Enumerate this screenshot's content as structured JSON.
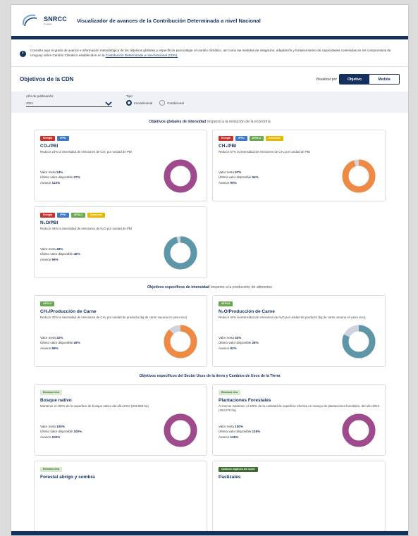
{
  "header": {
    "logo_text": "SNRCC",
    "logo_sub": "Uruguay",
    "title": "Visualizador de avances de la Contribución Determinada a nivel Nacional"
  },
  "intro": {
    "text": "Consulte aquí el grado de avance e información metodológica de los objetivos globales y específicos para mitigar el cambio climático, así como las medidas de mitigación, adaptación y fortalecimiento de capacidades contenidas en los compromisos de Uruguay sobre Cambio Climático establecidos en la ",
    "link": "Contribución Determinada a nivel Nacional (CDN)."
  },
  "section": {
    "title": "Objetivos de la CDN",
    "view_label": "Visualizar por",
    "view_options": [
      "Objetivo",
      "Medida"
    ]
  },
  "filters": {
    "year_label": "Año de publicación:",
    "year_value": "2021",
    "type_label": "Tipo:",
    "type_options": [
      "Incondicional",
      "Condicional"
    ]
  },
  "groups": [
    {
      "title": "Objetivos globales de intensidad",
      "subtitle": "respecto a la evolución de la economía"
    },
    {
      "title": "Objetivos específicos de intensidad",
      "subtitle": "respecto a la producción de alimentos"
    },
    {
      "title": "Objetivos específicos del Sector Usos de la tierra y Cambios de Usos de la Tierra",
      "subtitle": ""
    }
  ],
  "metric_labels": {
    "goal": "Valor meta",
    "last": "Último valor disponible",
    "progress": "Avance"
  },
  "colors": {
    "navy": "#14305f",
    "purple": "#9e4a8c",
    "orange": "#ef8a45",
    "teal": "#5d97a7",
    "track": "#cfd3dd"
  },
  "cards": [
    {
      "tags": [
        [
          "Energía",
          "#c9302c"
        ],
        [
          "IPPU",
          "#3e79c7"
        ]
      ],
      "title": "CO₂/PBI",
      "desc": "Reducir 24% la intensidad de emisiones de CO₂ por unidad de PBI",
      "goal": "24%",
      "last": "27%",
      "progress": "113%",
      "fill": 1.0,
      "color": "#9e4a8c"
    },
    {
      "tags": [
        [
          "Energía",
          "#c9302c"
        ],
        [
          "IPPU",
          "#3e79c7"
        ],
        [
          "AFOLU",
          "#6aa84f"
        ],
        [
          "Desechos",
          "#e6b800"
        ]
      ],
      "title": "CH₄/PBI",
      "desc": "Reducir 57% la intensidad de emisiones de CH₄ por unidad de PBI",
      "goal": "57%",
      "last": "54%",
      "progress": "95%",
      "fill": 0.95,
      "color": "#ef8a45"
    },
    {
      "tags": [
        [
          "Energía",
          "#c9302c"
        ],
        [
          "IPPU",
          "#3e79c7"
        ],
        [
          "AFOLU",
          "#6aa84f"
        ],
        [
          "Desechos",
          "#e6b800"
        ]
      ],
      "title": "N₂O/PBI",
      "desc": "Reducir 48% la intensidad de emisiones de N₂O por unidad de PBI",
      "goal": "48%",
      "last": "46%",
      "progress": "96%",
      "fill": 0.96,
      "color": "#5d97a7"
    },
    {
      "tags": [
        [
          "AFOLU",
          "#6aa84f"
        ]
      ],
      "title": "CH₄/Producción de Carne",
      "desc": "Reducir 32% la intensidad de emisiones de CH₄ por unidad de producto (kg de carne vacuna en peso vivo)",
      "goal": "32%",
      "last": "28%",
      "progress": "88%",
      "fill": 0.88,
      "color": "#ef8a45"
    },
    {
      "tags": [
        [
          "AFOLU",
          "#6aa84f"
        ]
      ],
      "title": "N₂O/Producción de Carne",
      "desc": "Reducir 34% la intensidad de emisiones de N₂O por unidad de producto (kg de carne vacuna en peso vivo)",
      "goal": "34%",
      "last": "28%",
      "progress": "82%",
      "fill": 0.82,
      "color": "#5d97a7"
    },
    {
      "tags": [
        [
          "Biomasa viva",
          "#d8ead0"
        ]
      ],
      "title": "Bosque nativo",
      "desc": "Mantener el 100% de la superficie de bosque nativo del año 2012 (849.960 ha)",
      "goal": "100%",
      "last": "100%",
      "progress": "100%",
      "fill": 1.0,
      "color": "#9e4a8c"
    },
    {
      "tags": [
        [
          "Biomasa viva",
          "#d8ead0"
        ]
      ],
      "title": "Plantaciones Forestales",
      "desc": "Al menos mantener el 100% de la cantidad de superficie efectiva en manejo de plantaciones forestales, del año 2012 (763.070 ha)",
      "goal": "100%",
      "last": "135%",
      "progress": "135%",
      "fill": 1.0,
      "color": "#9e4a8c"
    },
    {
      "tags": [
        [
          "Biomasa viva",
          "#d8ead0"
        ]
      ],
      "title": "Forestal abrigo y sombra",
      "desc": "",
      "goal": "",
      "last": "",
      "progress": "",
      "fill": 0,
      "color": "#9e4a8c"
    },
    {
      "tags": [
        [
          "Carbono orgánico del suelo",
          "#3e6b2f"
        ]
      ],
      "title": "Pastizales",
      "desc": "",
      "goal": "",
      "last": "",
      "progress": "",
      "fill": 0,
      "color": "#9e4a8c"
    }
  ]
}
